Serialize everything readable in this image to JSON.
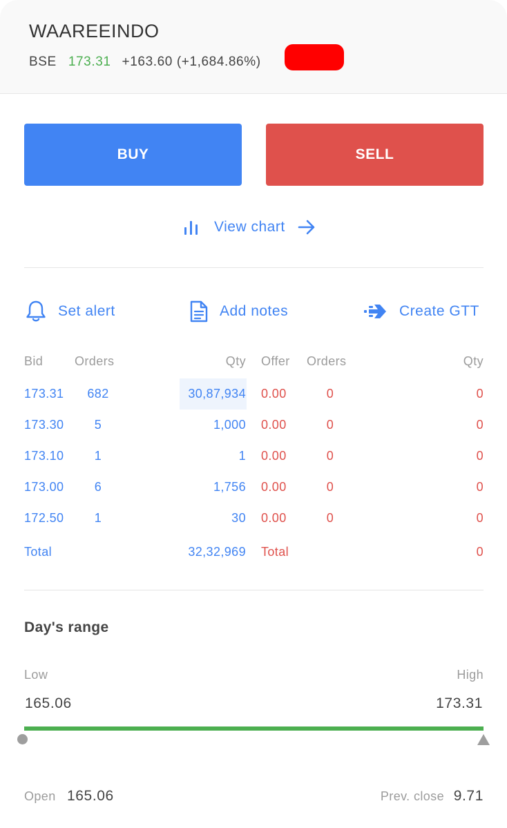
{
  "header": {
    "symbol": "WAAREEINDO",
    "exchange": "BSE",
    "ltp": "173.31",
    "change": "+163.60 (+1,684.86%)"
  },
  "actions": {
    "buy_label": "BUY",
    "sell_label": "SELL",
    "view_chart_label": "View chart",
    "set_alert_label": "Set alert",
    "add_notes_label": "Add notes",
    "create_gtt_label": "Create GTT"
  },
  "market_depth": {
    "headers": {
      "bid": "Bid",
      "bid_orders": "Orders",
      "bid_qty": "Qty",
      "offer": "Offer",
      "offer_orders": "Orders",
      "offer_qty": "Qty"
    },
    "rows": [
      {
        "bid": "173.31",
        "bid_orders": "682",
        "bid_qty": "30,87,934",
        "offer": "0.00",
        "offer_orders": "0",
        "offer_qty": "0"
      },
      {
        "bid": "173.30",
        "bid_orders": "5",
        "bid_qty": "1,000",
        "offer": "0.00",
        "offer_orders": "0",
        "offer_qty": "0"
      },
      {
        "bid": "173.10",
        "bid_orders": "1",
        "bid_qty": "1",
        "offer": "0.00",
        "offer_orders": "0",
        "offer_qty": "0"
      },
      {
        "bid": "173.00",
        "bid_orders": "6",
        "bid_qty": "1,756",
        "offer": "0.00",
        "offer_orders": "0",
        "offer_qty": "0"
      },
      {
        "bid": "172.50",
        "bid_orders": "1",
        "bid_qty": "30",
        "offer": "0.00",
        "offer_orders": "0",
        "offer_qty": "0"
      }
    ],
    "totals": {
      "bid_label": "Total",
      "bid_qty": "32,32,969",
      "offer_label": "Total",
      "offer_qty": "0"
    }
  },
  "days_range": {
    "title": "Day's range",
    "low_label": "Low",
    "high_label": "High",
    "low_value": "165.06",
    "high_value": "173.31",
    "position_fraction": 1.0
  },
  "stats": {
    "open_label": "Open",
    "open_value": "165.06",
    "prev_close_label": "Prev. close",
    "prev_close_value": "9.71"
  },
  "colors": {
    "accent_blue": "#4184f3",
    "sell_red": "#df514c",
    "positive_green": "#4caf50",
    "muted_gray": "#9b9b9b"
  },
  "icons": {
    "view_chart": "bar-chart-icon",
    "view_chart_arrow": "arrow-right-icon",
    "set_alert": "bell-icon",
    "add_notes": "document-icon",
    "create_gtt": "fast-forward-arrow-icon"
  }
}
